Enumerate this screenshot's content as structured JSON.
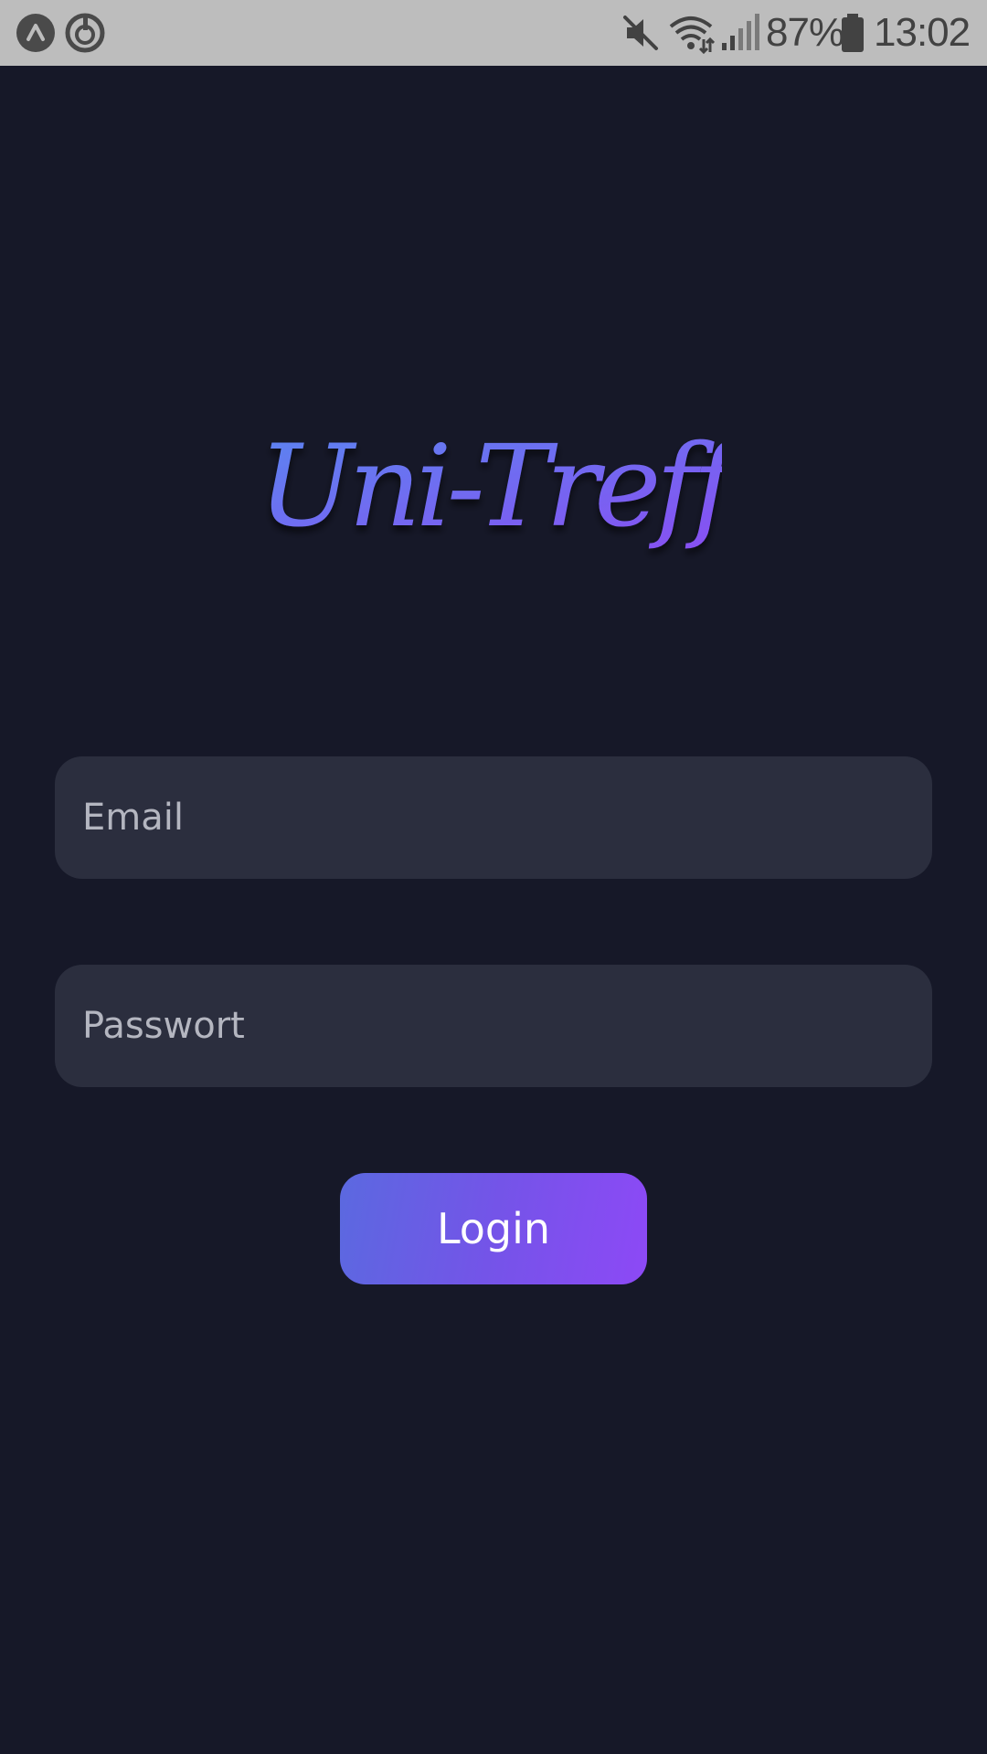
{
  "status_bar": {
    "battery_percent": "87%",
    "time": "13:02",
    "icons": [
      "app-notification-icon",
      "sync-notification-icon",
      "mute-icon",
      "wifi-icon",
      "signal-icon",
      "battery-icon"
    ]
  },
  "logo": {
    "text": "Uni-Treff",
    "gradient_start": "#5a86f0",
    "gradient_end": "#8a4cf2"
  },
  "form": {
    "email_placeholder": "Email",
    "email_value": "",
    "password_placeholder": "Passwort",
    "password_value": "",
    "login_label": "Login"
  },
  "colors": {
    "background": "#161828",
    "field_background": "#2b2e3e",
    "accent_start": "#5b69e0",
    "accent_end": "#8d49f6",
    "status_bar": "#bdbdbd"
  }
}
